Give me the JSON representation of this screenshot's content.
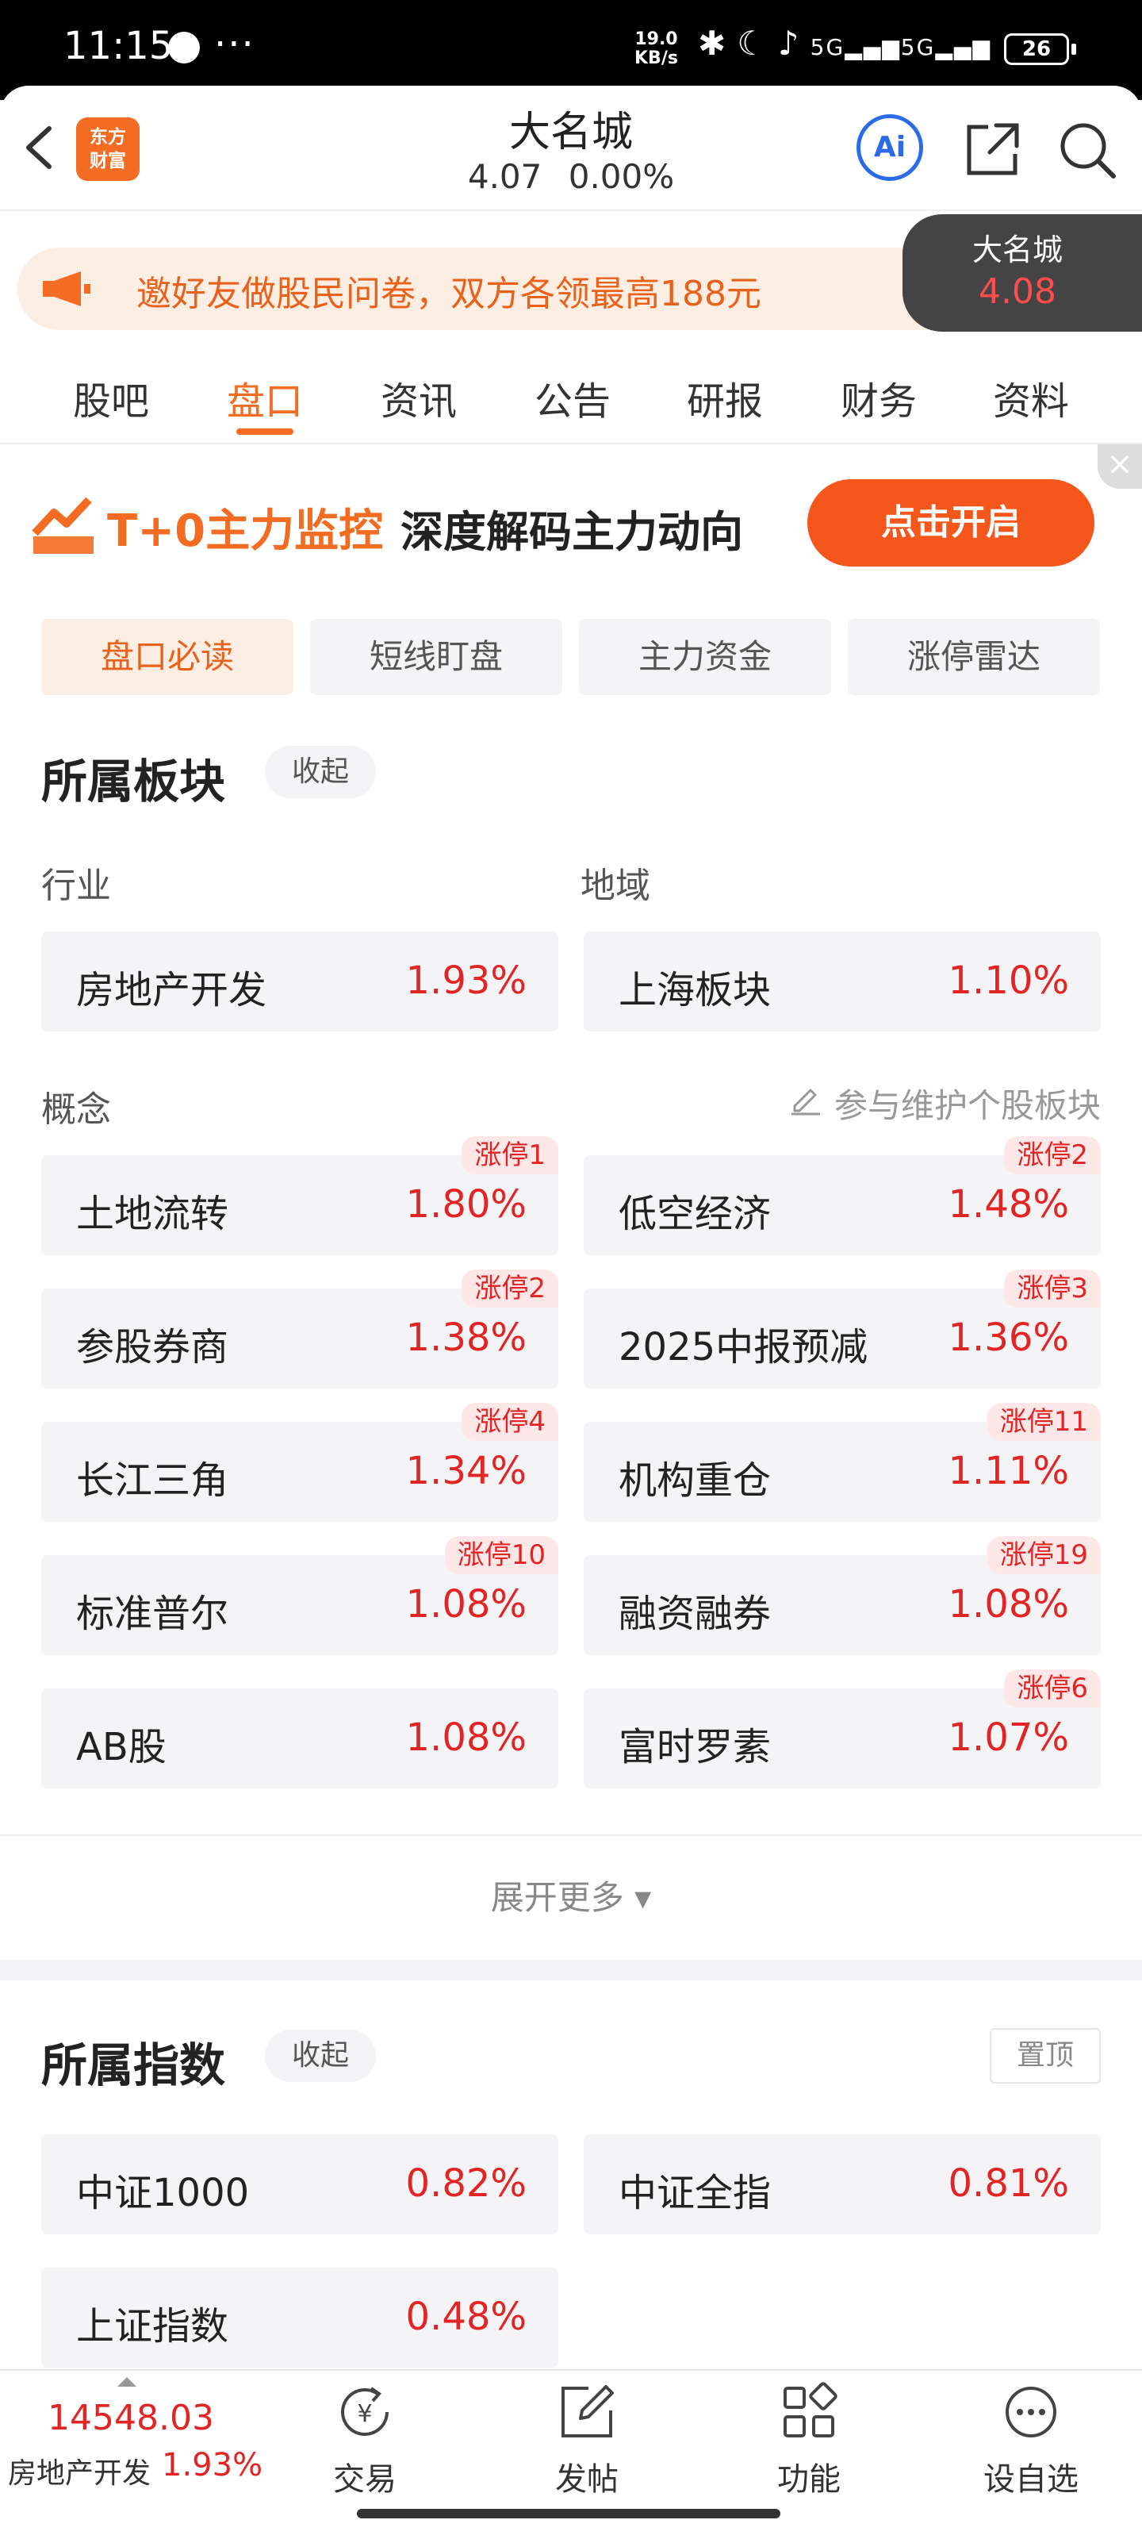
{
  "status_bar": {
    "time": "11:15",
    "dots": "···",
    "speed_top": "19.0",
    "speed_bottom": "KB/s",
    "network": "5G",
    "battery": "26"
  },
  "header": {
    "logo_line1": "东方",
    "logo_line2": "财富",
    "stock_name": "大名城",
    "price": "4.07",
    "change": "0.00%",
    "ai_label": "Ai"
  },
  "banner": {
    "text": "邀好友做股民问卷，双方各领最高188元"
  },
  "float_quote": {
    "name": "大名城",
    "price": "4.08"
  },
  "tabs": [
    {
      "label": "股吧"
    },
    {
      "label": "盘口"
    },
    {
      "label": "资讯"
    },
    {
      "label": "公告"
    },
    {
      "label": "研报"
    },
    {
      "label": "财务"
    },
    {
      "label": "资料"
    }
  ],
  "ad": {
    "title_a": "T+0主力监控",
    "title_b": "深度解码主力动向",
    "cta": "点击开启",
    "close": "×"
  },
  "subtabs": [
    {
      "label": "盘口必读"
    },
    {
      "label": "短线盯盘"
    },
    {
      "label": "主力资金"
    },
    {
      "label": "涨停雷达"
    }
  ],
  "sector": {
    "title": "所属板块",
    "collapse": "收起",
    "industry_label": "行业",
    "region_label": "地域",
    "industry": {
      "name": "房地产开发",
      "pct": "1.93%"
    },
    "region": {
      "name": "上海板块",
      "pct": "1.10%"
    },
    "concept_label": "概念",
    "maintain": "参与维护个股板块",
    "concepts": [
      {
        "name": "土地流转",
        "pct": "1.80%",
        "badge": "涨停1"
      },
      {
        "name": "低空经济",
        "pct": "1.48%",
        "badge": "涨停2"
      },
      {
        "name": "参股券商",
        "pct": "1.38%",
        "badge": "涨停2"
      },
      {
        "name": "2025中报预减",
        "pct": "1.36%",
        "badge": "涨停3"
      },
      {
        "name": "长江三角",
        "pct": "1.34%",
        "badge": "涨停4"
      },
      {
        "name": "机构重仓",
        "pct": "1.11%",
        "badge": "涨停11"
      },
      {
        "name": "标准普尔",
        "pct": "1.08%",
        "badge": "涨停10"
      },
      {
        "name": "融资融券",
        "pct": "1.08%",
        "badge": "涨停19"
      },
      {
        "name": "AB股",
        "pct": "1.08%",
        "badge": ""
      },
      {
        "name": "富时罗素",
        "pct": "1.07%",
        "badge": "涨停6"
      }
    ],
    "expand": "展开更多 ▾"
  },
  "index": {
    "title": "所属指数",
    "collapse": "收起",
    "pin": "置顶",
    "items": [
      {
        "name": "中证1000",
        "pct": "0.82%"
      },
      {
        "name": "中证全指",
        "pct": "0.81%"
      },
      {
        "name": "上证指数",
        "pct": "0.48%"
      }
    ]
  },
  "bottom_bar": {
    "index_value": "14548.03",
    "index_name": "房地产开发",
    "index_pct": "1.93%",
    "items": [
      {
        "label": "交易"
      },
      {
        "label": "发帖"
      },
      {
        "label": "功能"
      },
      {
        "label": "设自选"
      }
    ]
  },
  "colors": {
    "accent": "#f36c21",
    "up": "#e32424",
    "ai": "#2b6be8"
  }
}
